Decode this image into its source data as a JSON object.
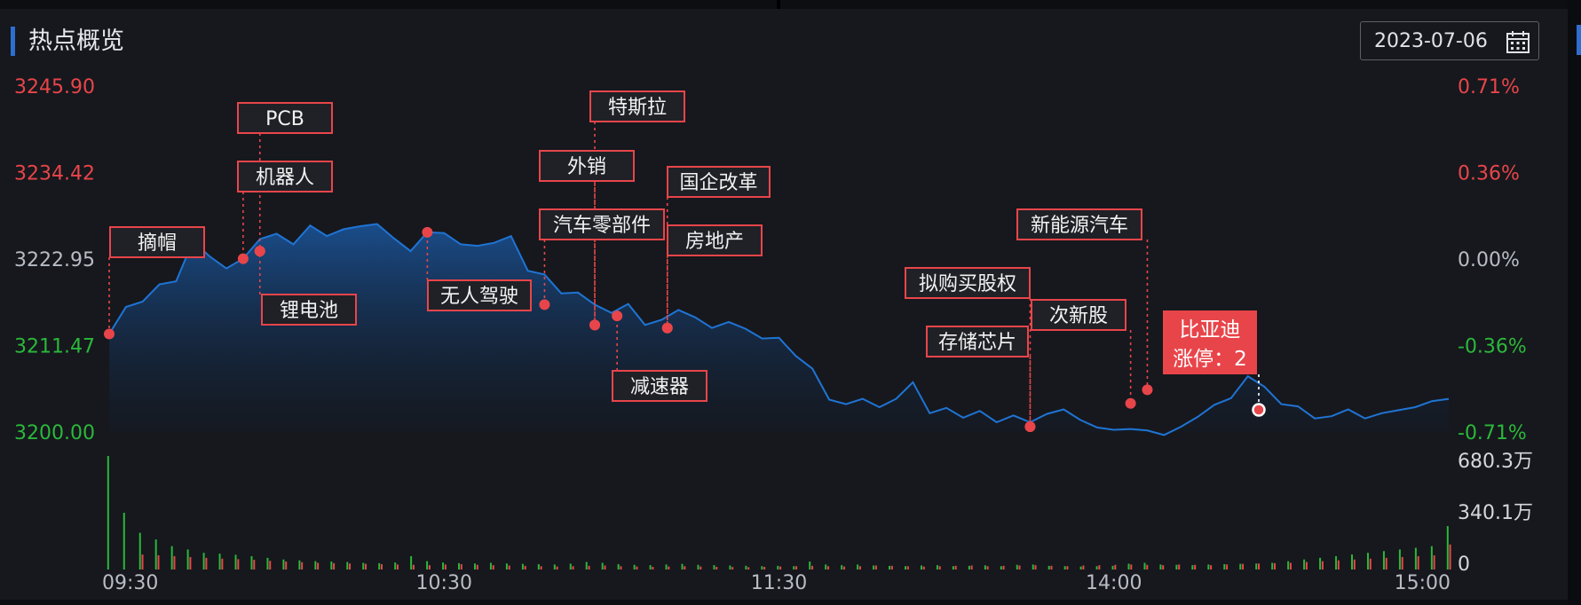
{
  "header": {
    "title": "热点概览",
    "date": "2023-07-06",
    "calendar_icon": "calendar-icon"
  },
  "colors": {
    "up": "#e8454a",
    "down": "#2bb83a",
    "line": "#1f74d4",
    "neutral": "#b8bcc4",
    "background": "#16181d"
  },
  "chart_data": {
    "type": "line",
    "title": "",
    "y_left_ticks": [
      "3245.90",
      "3234.42",
      "3222.95",
      "3211.47",
      "3200.00"
    ],
    "y_right_ticks": [
      "0.71%",
      "0.36%",
      "0.00%",
      "-0.36%",
      "-0.71%"
    ],
    "ylim": [
      3200.0,
      3245.9
    ],
    "reference_value": 3222.95,
    "x_ticks": [
      "09:30",
      "10:30",
      "11:30",
      "14:00",
      "15:00"
    ],
    "volume_ticks": [
      "680.3万",
      "340.1万",
      "0"
    ],
    "volume_max": 680.3,
    "volume_unit": "万",
    "series": [
      {
        "x": [
          0,
          3,
          6,
          9,
          12,
          15,
          18,
          21,
          24,
          27,
          30,
          33,
          36,
          39,
          42,
          45,
          48,
          51,
          54,
          57,
          60,
          63,
          66,
          69,
          72,
          75,
          78,
          81,
          84,
          87,
          90,
          93,
          96,
          99,
          102,
          105,
          108,
          111,
          114,
          117,
          120,
          123,
          126,
          129,
          132,
          135,
          138,
          141,
          144,
          147,
          150,
          153,
          156,
          159,
          162,
          165,
          168,
          171,
          174,
          177,
          180,
          183,
          186,
          189,
          192,
          195,
          198,
          201,
          204,
          207,
          210,
          213,
          216,
          219,
          222,
          225,
          228,
          231,
          234,
          237,
          240
        ],
        "y": [
          3213.0,
          3216.6,
          3217.3,
          3219.6,
          3220.0,
          3225.3,
          3223.3,
          3221.7,
          3223.0,
          3225.6,
          3226.3,
          3224.9,
          3227.4,
          3226.0,
          3226.9,
          3227.3,
          3227.6,
          3225.7,
          3224.0,
          3226.5,
          3226.4,
          3224.9,
          3224.7,
          3225.1,
          3226.0,
          3221.4,
          3220.9,
          3218.4,
          3218.5,
          3216.9,
          3215.8,
          3217.0,
          3214.2,
          3214.9,
          3216.2,
          3215.2,
          3213.8,
          3214.6,
          3213.7,
          3212.4,
          3212.5,
          3210.1,
          3208.4,
          3204.3,
          3203.7,
          3204.4,
          3203.3,
          3204.4,
          3206.6,
          3202.5,
          3203.2,
          3201.9,
          3202.8,
          3201.3,
          3202.2,
          3201.3,
          3202.4,
          3203.0,
          3201.6,
          3200.6,
          3200.3,
          3200.4,
          3200.2,
          3199.6,
          3200.7,
          3202.0,
          3203.6,
          3204.5,
          3207.4,
          3206.0,
          3203.7,
          3203.4,
          3201.8,
          3202.1,
          3203.0,
          3201.8,
          3202.5,
          3202.9,
          3203.3,
          3204.1,
          3204.4
        ]
      }
    ],
    "volume": {
      "up": [
        680,
        340,
        220,
        180,
        140,
        120,
        100,
        95,
        88,
        80,
        70,
        60,
        55,
        50,
        48,
        45,
        40,
        38,
        42,
        80,
        50,
        42,
        38,
        36,
        40,
        36,
        34,
        32,
        30,
        35,
        45,
        40,
        32,
        28,
        26,
        30,
        34,
        28,
        26,
        24,
        22,
        20,
        22,
        20,
        48,
        30,
        26,
        30,
        24,
        22,
        20,
        24,
        26,
        20,
        22,
        25,
        20,
        28,
        30,
        22,
        20,
        18,
        20,
        22,
        35,
        40,
        30,
        28,
        26,
        30,
        32,
        34,
        36,
        40,
        50,
        60,
        70,
        80,
        90,
        100,
        110,
        120,
        130,
        140,
        260
      ],
      "down": [
        0,
        0,
        90,
        85,
        80,
        75,
        70,
        65,
        62,
        58,
        52,
        48,
        44,
        40,
        38,
        36,
        34,
        32,
        30,
        28,
        26,
        30,
        32,
        28,
        26,
        24,
        22,
        20,
        18,
        20,
        22,
        24,
        20,
        18,
        16,
        18,
        20,
        18,
        16,
        15,
        14,
        16,
        18,
        20,
        22,
        20,
        18,
        20,
        24,
        22,
        20,
        18,
        20,
        22,
        24,
        20,
        22,
        24,
        26,
        22,
        20,
        24,
        26,
        28,
        30,
        28,
        26,
        30,
        28,
        26,
        30,
        34,
        36,
        38,
        40,
        45,
        50,
        55,
        60,
        65,
        70,
        75,
        80,
        85,
        150
      ]
    },
    "annotations": [
      {
        "label": "摘帽",
        "t": 0,
        "value": 3213.0
      },
      {
        "label": "机器人",
        "t": 24,
        "value": 3223.0
      },
      {
        "label": "PCB",
        "t": 27,
        "value": 3224.0
      },
      {
        "label": "锂电池",
        "t": 27,
        "value": 3224.0
      },
      {
        "label": "无人驾驶",
        "t": 57,
        "value": 3226.5
      },
      {
        "label": "汽车零部件",
        "t": 78,
        "value": 3216.9
      },
      {
        "label": "外销",
        "t": 87,
        "value": 3214.2
      },
      {
        "label": "特斯拉",
        "t": 87,
        "value": 3214.2
      },
      {
        "label": "减速器",
        "t": 91,
        "value": 3215.4
      },
      {
        "label": "国企改革",
        "t": 100,
        "value": 3213.8
      },
      {
        "label": "房地产",
        "t": 100,
        "value": 3213.8
      },
      {
        "label": "存储芯片",
        "t": 165,
        "value": 3200.7
      },
      {
        "label": "拟购买股权",
        "t": 165,
        "value": 3200.7
      },
      {
        "label": "次新股",
        "t": 183,
        "value": 3203.8
      },
      {
        "label": "新能源汽车",
        "t": 186,
        "value": 3205.6
      },
      {
        "label": "比亚迪",
        "sub": "涨停：2",
        "t": 207,
        "value": 3202.2,
        "highlight": true
      }
    ]
  }
}
